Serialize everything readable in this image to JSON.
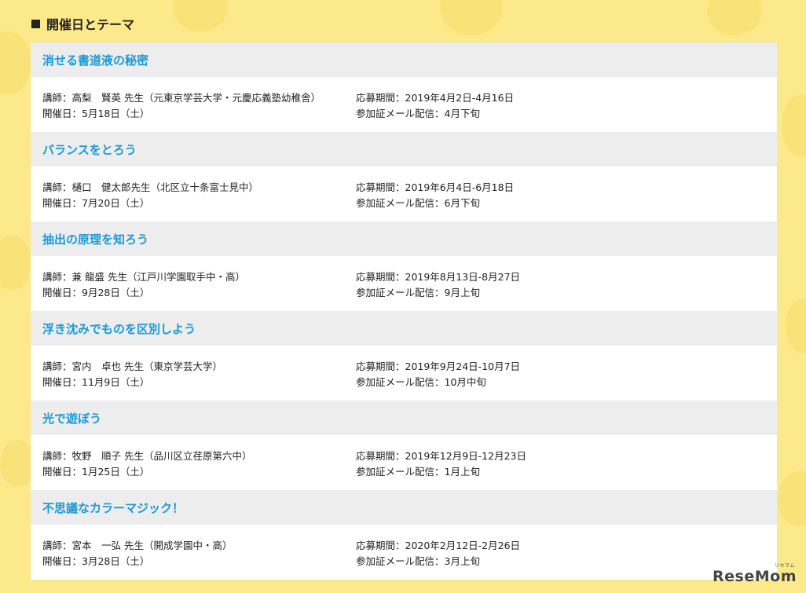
{
  "section": {
    "heading": "開催日とテーマ"
  },
  "items": [
    {
      "title": "消せる書道液の秘密",
      "lecturer": "講師：高梨　賢英 先生（元東京学芸大学・元慶応義塾幼稚舎）",
      "date": "開催日：5月18日（土）",
      "period": "応募期間：2019年4月2日-4月16日",
      "delivery": "参加証メール配信：4月下旬"
    },
    {
      "title": "バランスをとろう",
      "lecturer": "講師：樋口　健太郎先生（北区立十条富士見中）",
      "date": "開催日：7月20日（土）",
      "period": "応募期間：2019年6月4日-6月18日",
      "delivery": "参加証メール配信：6月下旬"
    },
    {
      "title": "抽出の原理を知ろう",
      "lecturer": "講師：兼 龍盛 先生（江戸川学園取手中・高）",
      "date": "開催日：9月28日（土）",
      "period": "応募期間：2019年8月13日-8月27日",
      "delivery": "参加証メール配信：9月上旬"
    },
    {
      "title": "浮き沈みでものを区別しよう",
      "lecturer": "講師：宮内　卓也 先生（東京学芸大学）",
      "date": "開催日：11月9日（土）",
      "period": "応募期間：2019年9月24日-10月7日",
      "delivery": "参加証メール配信：10月中旬"
    },
    {
      "title": "光で遊ぼう",
      "lecturer": "講師：牧野　順子 先生（品川区立荏原第六中）",
      "date": "開催日：1月25日（土）",
      "period": "応募期間：2019年12月9日-12月23日",
      "delivery": "参加証メール配信：1月上旬"
    },
    {
      "title": "不思議なカラーマジック！",
      "lecturer": "講師：宮本　一弘 先生（開成学園中・高）",
      "date": "開催日：3月28日（土）",
      "period": "応募期間：2020年2月12日-2月26日",
      "delivery": "参加証メール配信：3月上旬"
    }
  ],
  "watermark": {
    "logo_text": "ReseMom",
    "logo_sub": "リセマム"
  },
  "colors": {
    "background": "#fbe98a",
    "title_bar": "#ededed",
    "title_text": "#1a9ad6",
    "card": "#ffffff"
  }
}
